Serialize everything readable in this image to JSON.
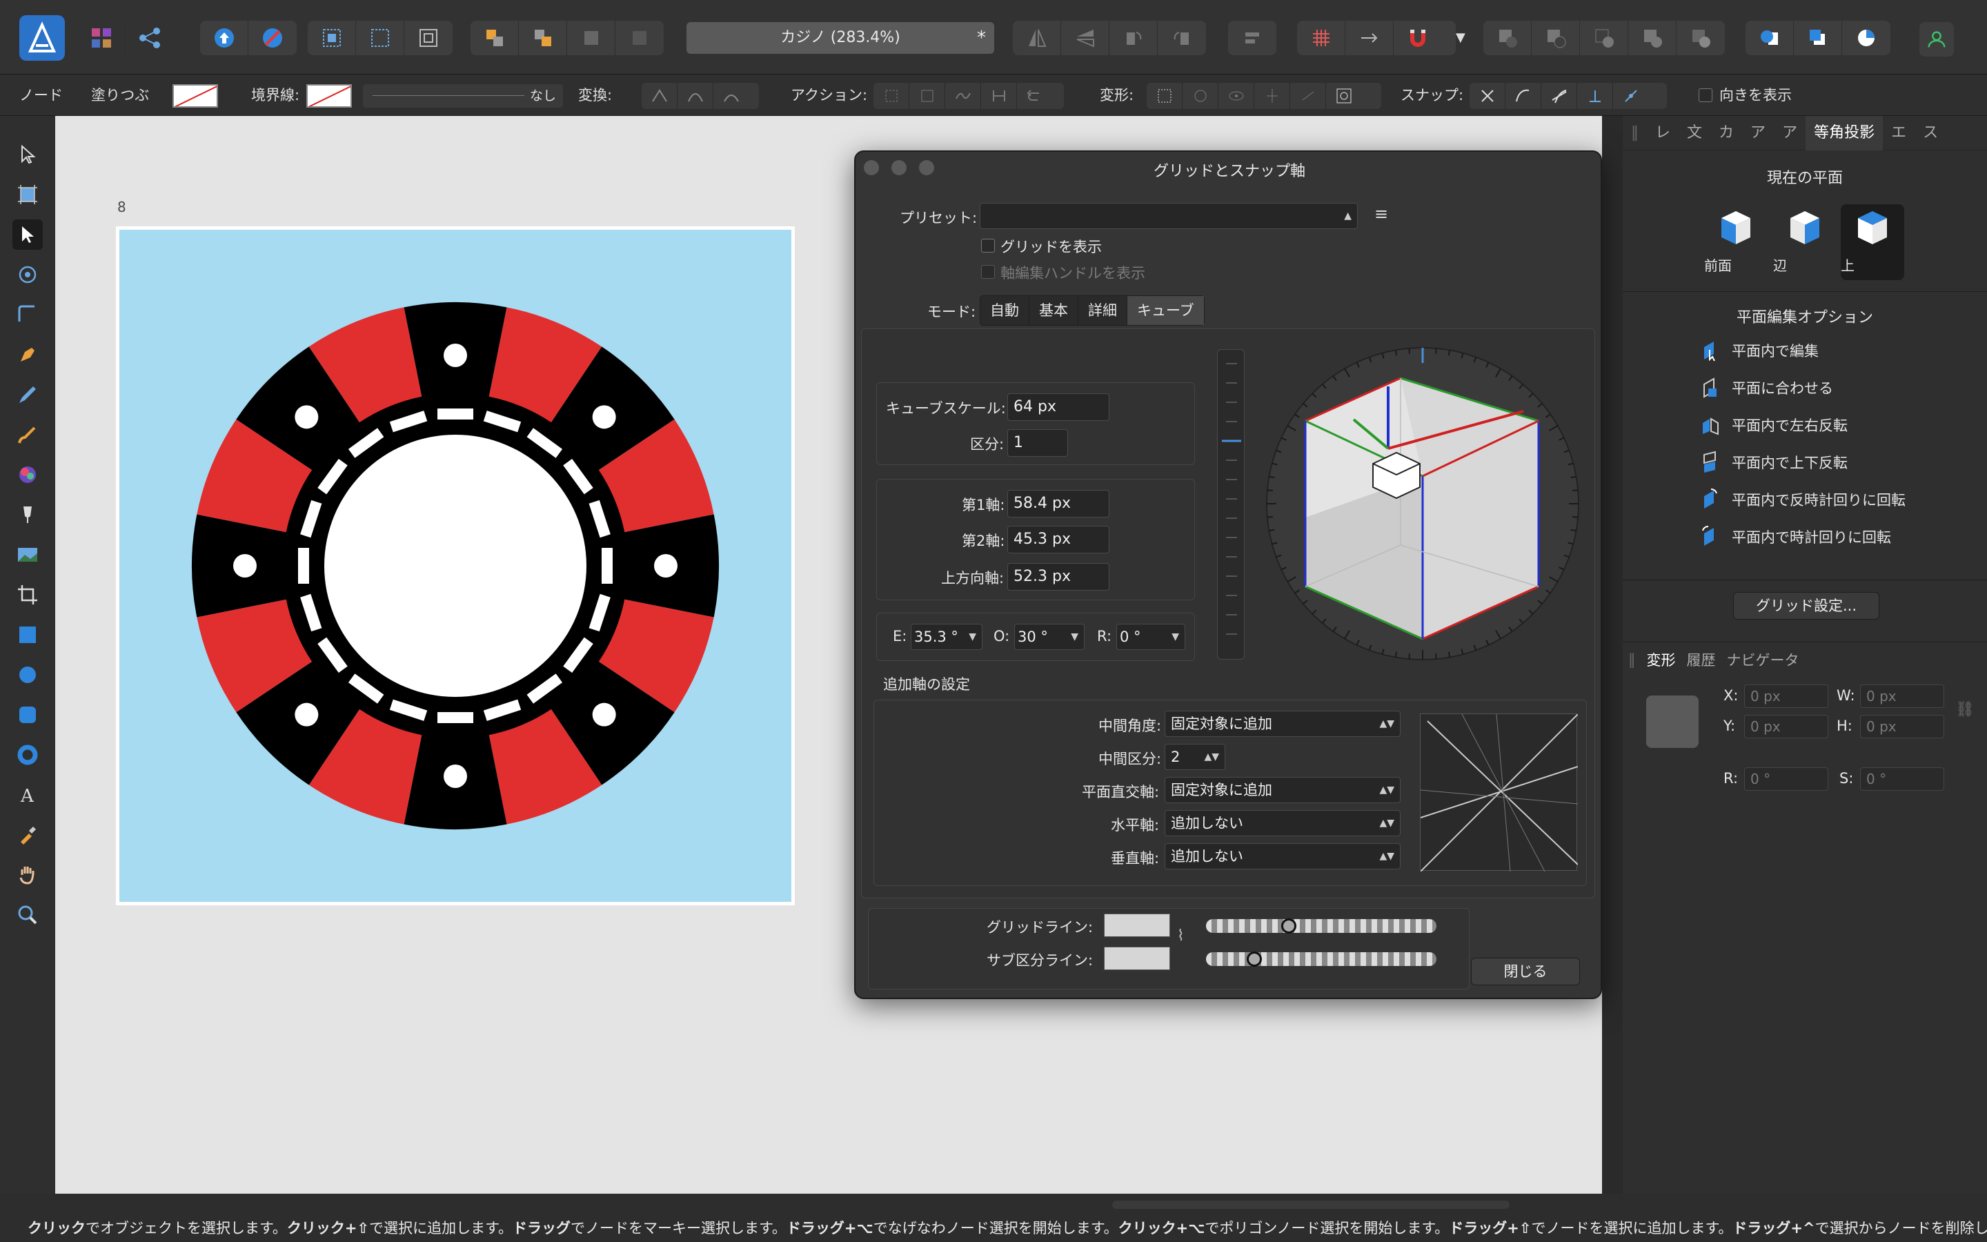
{
  "toolbar": {
    "document_title": "カジノ (283.4%)",
    "unsaved_mark": "*"
  },
  "contextbar": {
    "node_label": "ノード",
    "fill_label": "塗りつぶ",
    "stroke_label": "境界線:",
    "stroke_value": "なし",
    "transform_label": "変換:",
    "action_label": "アクション:",
    "deform_label": "変形:",
    "snap_label": "スナップ:",
    "show_orientation": "向きを表示"
  },
  "canvas": {
    "artboard_label": "8",
    "colors": {
      "background": "#a7dbf1",
      "red": "#e12f2f",
      "black": "#000000",
      "white": "#ffffff"
    }
  },
  "dialog": {
    "title": "グリッドとスナップ軸",
    "preset_label": "プリセット:",
    "preset_value": "",
    "show_grid": "グリッドを表示",
    "show_axis_handles": "軸編集ハンドルを表示",
    "mode_label": "モード:",
    "modes": [
      "自動",
      "基本",
      "詳細",
      "キューブ"
    ],
    "active_mode": "キューブ",
    "cube_scale_label": "キューブスケール:",
    "cube_scale_value": "64 px",
    "division_label": "区分:",
    "division_value": "1",
    "axis1_label": "第1軸:",
    "axis1_value": "58.4 px",
    "axis2_label": "第2軸:",
    "axis2_value": "45.3 px",
    "up_axis_label": "上方向軸:",
    "up_axis_value": "52.3 px",
    "e_label": "E:",
    "e_value": "35.3 °",
    "o_label": "O:",
    "o_value": "30 °",
    "r_label": "R:",
    "r_value": "0 °",
    "extra_axis_title": "追加軸の設定",
    "mid_angle_label": "中間角度:",
    "mid_angle_value": "固定対象に追加",
    "mid_division_label": "中間区分:",
    "mid_division_value": "2",
    "plane_ortho_label": "平面直交軸:",
    "plane_ortho_value": "固定対象に追加",
    "horizontal_label": "水平軸:",
    "horizontal_value": "追加しない",
    "vertical_label": "垂直軸:",
    "vertical_value": "追加しない",
    "grid_line_label": "グリッドライン:",
    "sub_line_label": "サブ区分ライン:",
    "grid_line_opacity": 0.35,
    "sub_line_opacity": 0.19,
    "close_button": "閉じる"
  },
  "rightpanel": {
    "tabs": [
      "レ",
      "文",
      "カ",
      "ア",
      "ア",
      "等角投影",
      "エ",
      "ス"
    ],
    "active_tab": "等角投影",
    "current_plane_title": "現在の平面",
    "planes": [
      "前面",
      "辺",
      "上"
    ],
    "selected_plane": "上",
    "plane_options_title": "平面編集オプション",
    "options": [
      "平面内で編集",
      "平面に合わせる",
      "平面内で左右反転",
      "平面内で上下反転",
      "平面内で反時計回りに回転",
      "平面内で時計回りに回転"
    ],
    "grid_settings_button": "グリッド設定...",
    "transform_tabs": [
      "変形",
      "履歴",
      "ナビゲータ"
    ],
    "active_transform_tab": "変形",
    "x_label": "X:",
    "x_value": "0 px",
    "y_label": "Y:",
    "y_value": "0 px",
    "w_label": "W:",
    "w_value": "0 px",
    "h_label": "H:",
    "h_value": "0 px",
    "r_label": "R:",
    "r_value": "0 °",
    "s_label": "S:",
    "s_value": "0 °"
  },
  "status": {
    "segments": [
      {
        "b": "クリック",
        "t": "でオブジェクトを選択します。"
      },
      {
        "b": "クリック+⇧",
        "t": "で選択に追加します。"
      },
      {
        "b": "ドラッグ",
        "t": "でノードをマーキー選択します。"
      },
      {
        "b": "ドラッグ+⌥",
        "t": "でなげなわノード選択を開始します。"
      },
      {
        "b": "クリック+⌥",
        "t": "でポリゴンノード選択を開始します。"
      },
      {
        "b": "ドラッグ+⇧",
        "t": "でノードを選択に追加します。"
      },
      {
        "b": "ドラッグ+^",
        "t": "で選択からノードを削除します。"
      }
    ]
  }
}
